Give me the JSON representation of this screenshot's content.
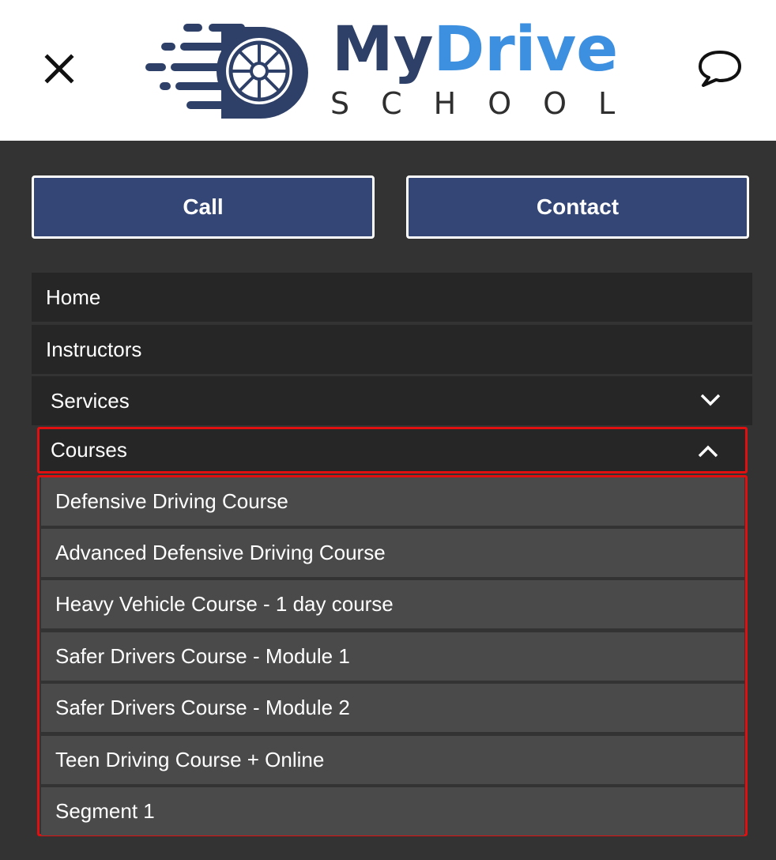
{
  "header": {
    "logo_my": "My",
    "logo_drive": "Drive",
    "logo_school": "SCHOOL",
    "close_icon": "close-icon",
    "chat_icon": "chat-bubble-icon"
  },
  "actions": {
    "call_label": "Call",
    "contact_label": "Contact"
  },
  "nav": {
    "items": [
      {
        "label": "Home"
      },
      {
        "label": "Instructors"
      },
      {
        "label": "Services",
        "icon": "chevron-down-icon"
      },
      {
        "label": "Courses",
        "icon": "chevron-up-icon",
        "expanded": true
      }
    ],
    "courses_submenu": [
      {
        "label": "Defensive Driving Course"
      },
      {
        "label": "Advanced Defensive Driving Course"
      },
      {
        "label": "Heavy Vehicle Course - 1 day course"
      },
      {
        "label": "Safer Drivers Course - Module 1"
      },
      {
        "label": "Safer Drivers Course - Module 2"
      },
      {
        "label": "Teen Driving Course + Online"
      },
      {
        "label": "Segment 1"
      }
    ]
  },
  "colors": {
    "brand_navy": "#2e4068",
    "brand_blue": "#3d8fe0",
    "button_bg": "#344675",
    "menu_bg": "#262626",
    "submenu_bg": "#4a4a4a",
    "highlight": "#e01010"
  }
}
